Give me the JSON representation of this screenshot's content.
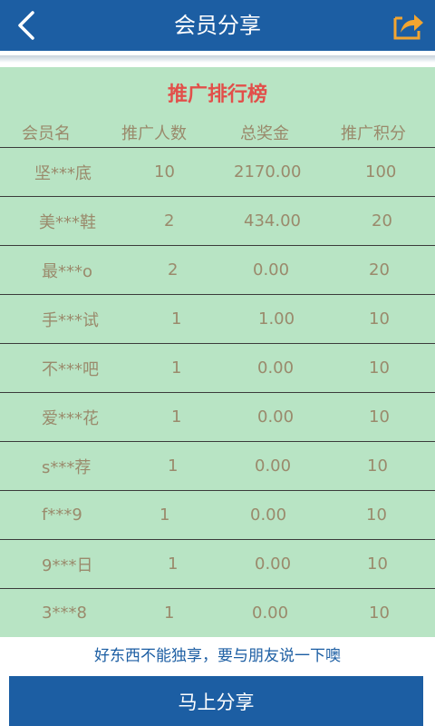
{
  "header": {
    "title": "会员分享"
  },
  "ranking": {
    "title": "推广排行榜",
    "columns": [
      "会员名",
      "推广人数",
      "总奖金",
      "推广积分"
    ],
    "rows": [
      {
        "name": "坚***底",
        "count": "10",
        "bonus": "2170.00",
        "points": "100"
      },
      {
        "name": "美***鞋",
        "count": "2",
        "bonus": "434.00",
        "points": "20"
      },
      {
        "name": "最***o",
        "count": "2",
        "bonus": "0.00",
        "points": "20"
      },
      {
        "name": "手***试",
        "count": "1",
        "bonus": "1.00",
        "points": "10"
      },
      {
        "name": "不***吧",
        "count": "1",
        "bonus": "0.00",
        "points": "10"
      },
      {
        "name": "爱***花",
        "count": "1",
        "bonus": "0.00",
        "points": "10"
      },
      {
        "name": "s***荐",
        "count": "1",
        "bonus": "0.00",
        "points": "10"
      },
      {
        "name": "f***9",
        "count": "1",
        "bonus": "0.00",
        "points": "10"
      },
      {
        "name": "9***日",
        "count": "1",
        "bonus": "0.00",
        "points": "10"
      },
      {
        "name": "3***8",
        "count": "1",
        "bonus": "0.00",
        "points": "10"
      }
    ]
  },
  "footer": {
    "tagline": "好东西不能独享，要与朋友说一下噢",
    "share_button_label": "马上分享"
  },
  "colors": {
    "primary": "#1c5ea3",
    "panel_bg": "#b8e4c4",
    "title_red": "#e24f4a",
    "text_tan": "#9a8a6c",
    "share_icon_orange": "#f3a530"
  },
  "icons": {
    "back": "chevron-left-icon",
    "share": "share-arrow-icon"
  }
}
